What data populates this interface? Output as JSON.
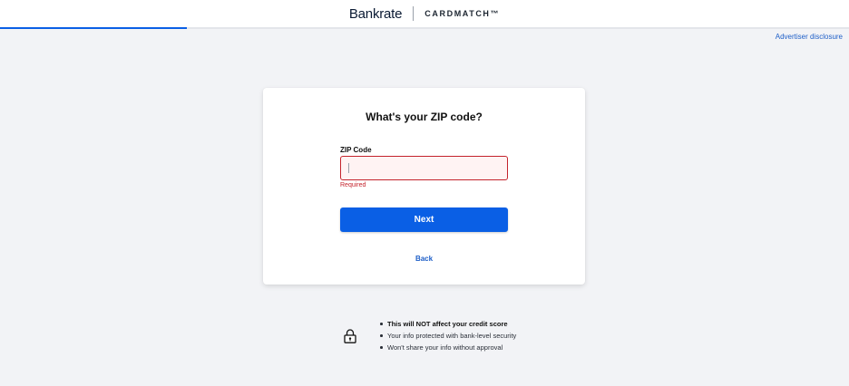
{
  "header": {
    "brand_name": "Bankrate",
    "product_name": "CARDMATCH™"
  },
  "progress": {
    "fraction": 0.22
  },
  "advertiser_disclosure": "Advertiser disclosure",
  "form": {
    "title": "What's your ZIP code?",
    "zip_label": "ZIP Code",
    "zip_value": "",
    "zip_error": "Required",
    "next_label": "Next",
    "back_label": "Back"
  },
  "assurance": {
    "icon": "lock-icon",
    "items": [
      "This will NOT affect your credit score",
      "Your info protected with bank-level security",
      "Won't share your info without approval"
    ]
  },
  "colors": {
    "accent": "#0a5fe5",
    "error": "#c4232c",
    "background": "#f2f3f6"
  }
}
